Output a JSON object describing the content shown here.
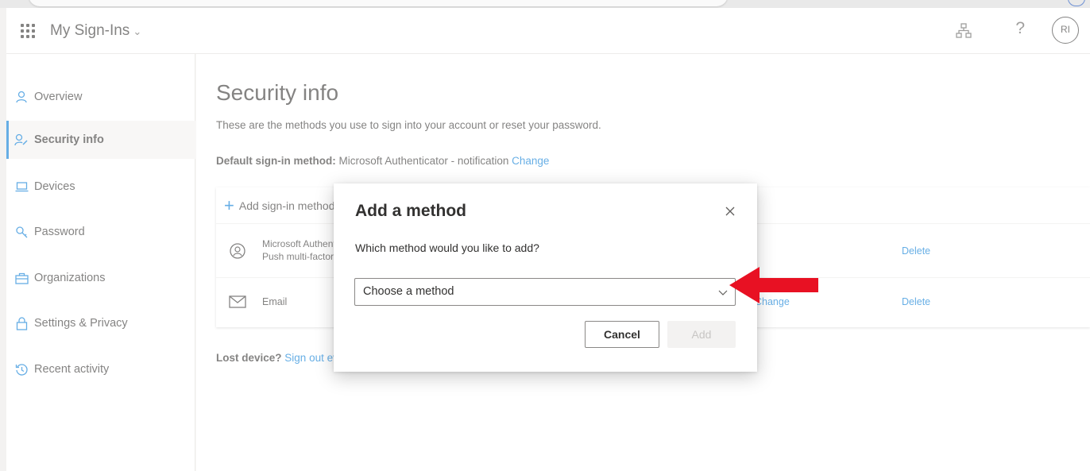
{
  "header": {
    "app_title": "My Sign-Ins",
    "avatar_initials": "RI"
  },
  "sidebar": {
    "items": [
      {
        "label": "Overview",
        "icon": "person-icon"
      },
      {
        "label": "Security info",
        "icon": "security-info-icon",
        "active": true
      },
      {
        "label": "Devices",
        "icon": "laptop-icon"
      },
      {
        "label": "Password",
        "icon": "key-icon"
      },
      {
        "label": "Organizations",
        "icon": "briefcase-icon"
      },
      {
        "label": "Settings & Privacy",
        "icon": "lock-icon"
      },
      {
        "label": "Recent activity",
        "icon": "history-icon"
      }
    ]
  },
  "main": {
    "title": "Security info",
    "description": "These are the methods you use to sign into your account or reset your password.",
    "default_label": "Default sign-in method:",
    "default_value": "Microsoft Authenticator - notification",
    "default_change": "Change",
    "add_label": "Add sign-in method",
    "methods": [
      {
        "name_line1": "Microsoft Authenticator",
        "name_line2": "Push multi-factor authentication (MFA)",
        "change": "",
        "delete": "Delete"
      },
      {
        "name_line1": "Email",
        "change": "Change",
        "delete": "Delete"
      }
    ],
    "lost_label": "Lost device?",
    "lost_link": "Sign out everywhere"
  },
  "dialog": {
    "title": "Add a method",
    "question": "Which method would you like to add?",
    "select_placeholder": "Choose a method",
    "cancel_label": "Cancel",
    "add_label": "Add"
  },
  "colors": {
    "accent": "#0078d4",
    "annotation_arrow": "#e81123"
  }
}
